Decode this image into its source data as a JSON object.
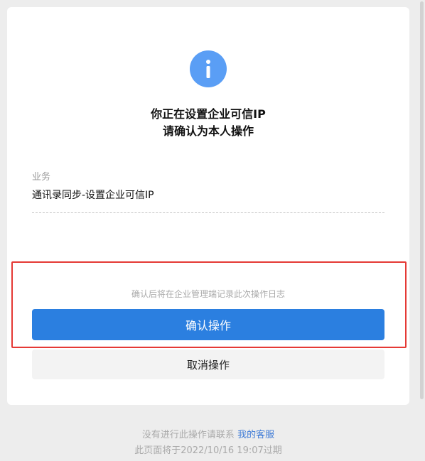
{
  "dialog": {
    "title_line1": "你正在设置企业可信IP",
    "title_line2": "请确认为本人操作",
    "field_label": "业务",
    "field_value": "通讯录同步-设置企业可信IP",
    "hint": "确认后将在企业管理端记录此次操作日志",
    "confirm_label": "确认操作",
    "cancel_label": "取消操作"
  },
  "footer": {
    "contact_text": "没有进行此操作请联系 ",
    "contact_link": "我的客服",
    "expiry_text": "此页面将于2022/10/16 19:07过期"
  },
  "colors": {
    "accent": "#2b7fe0",
    "info_icon": "#5a9ef5",
    "highlight": "#e53935",
    "link": "#3d7ad6"
  },
  "icons": {
    "info": "info-icon"
  }
}
